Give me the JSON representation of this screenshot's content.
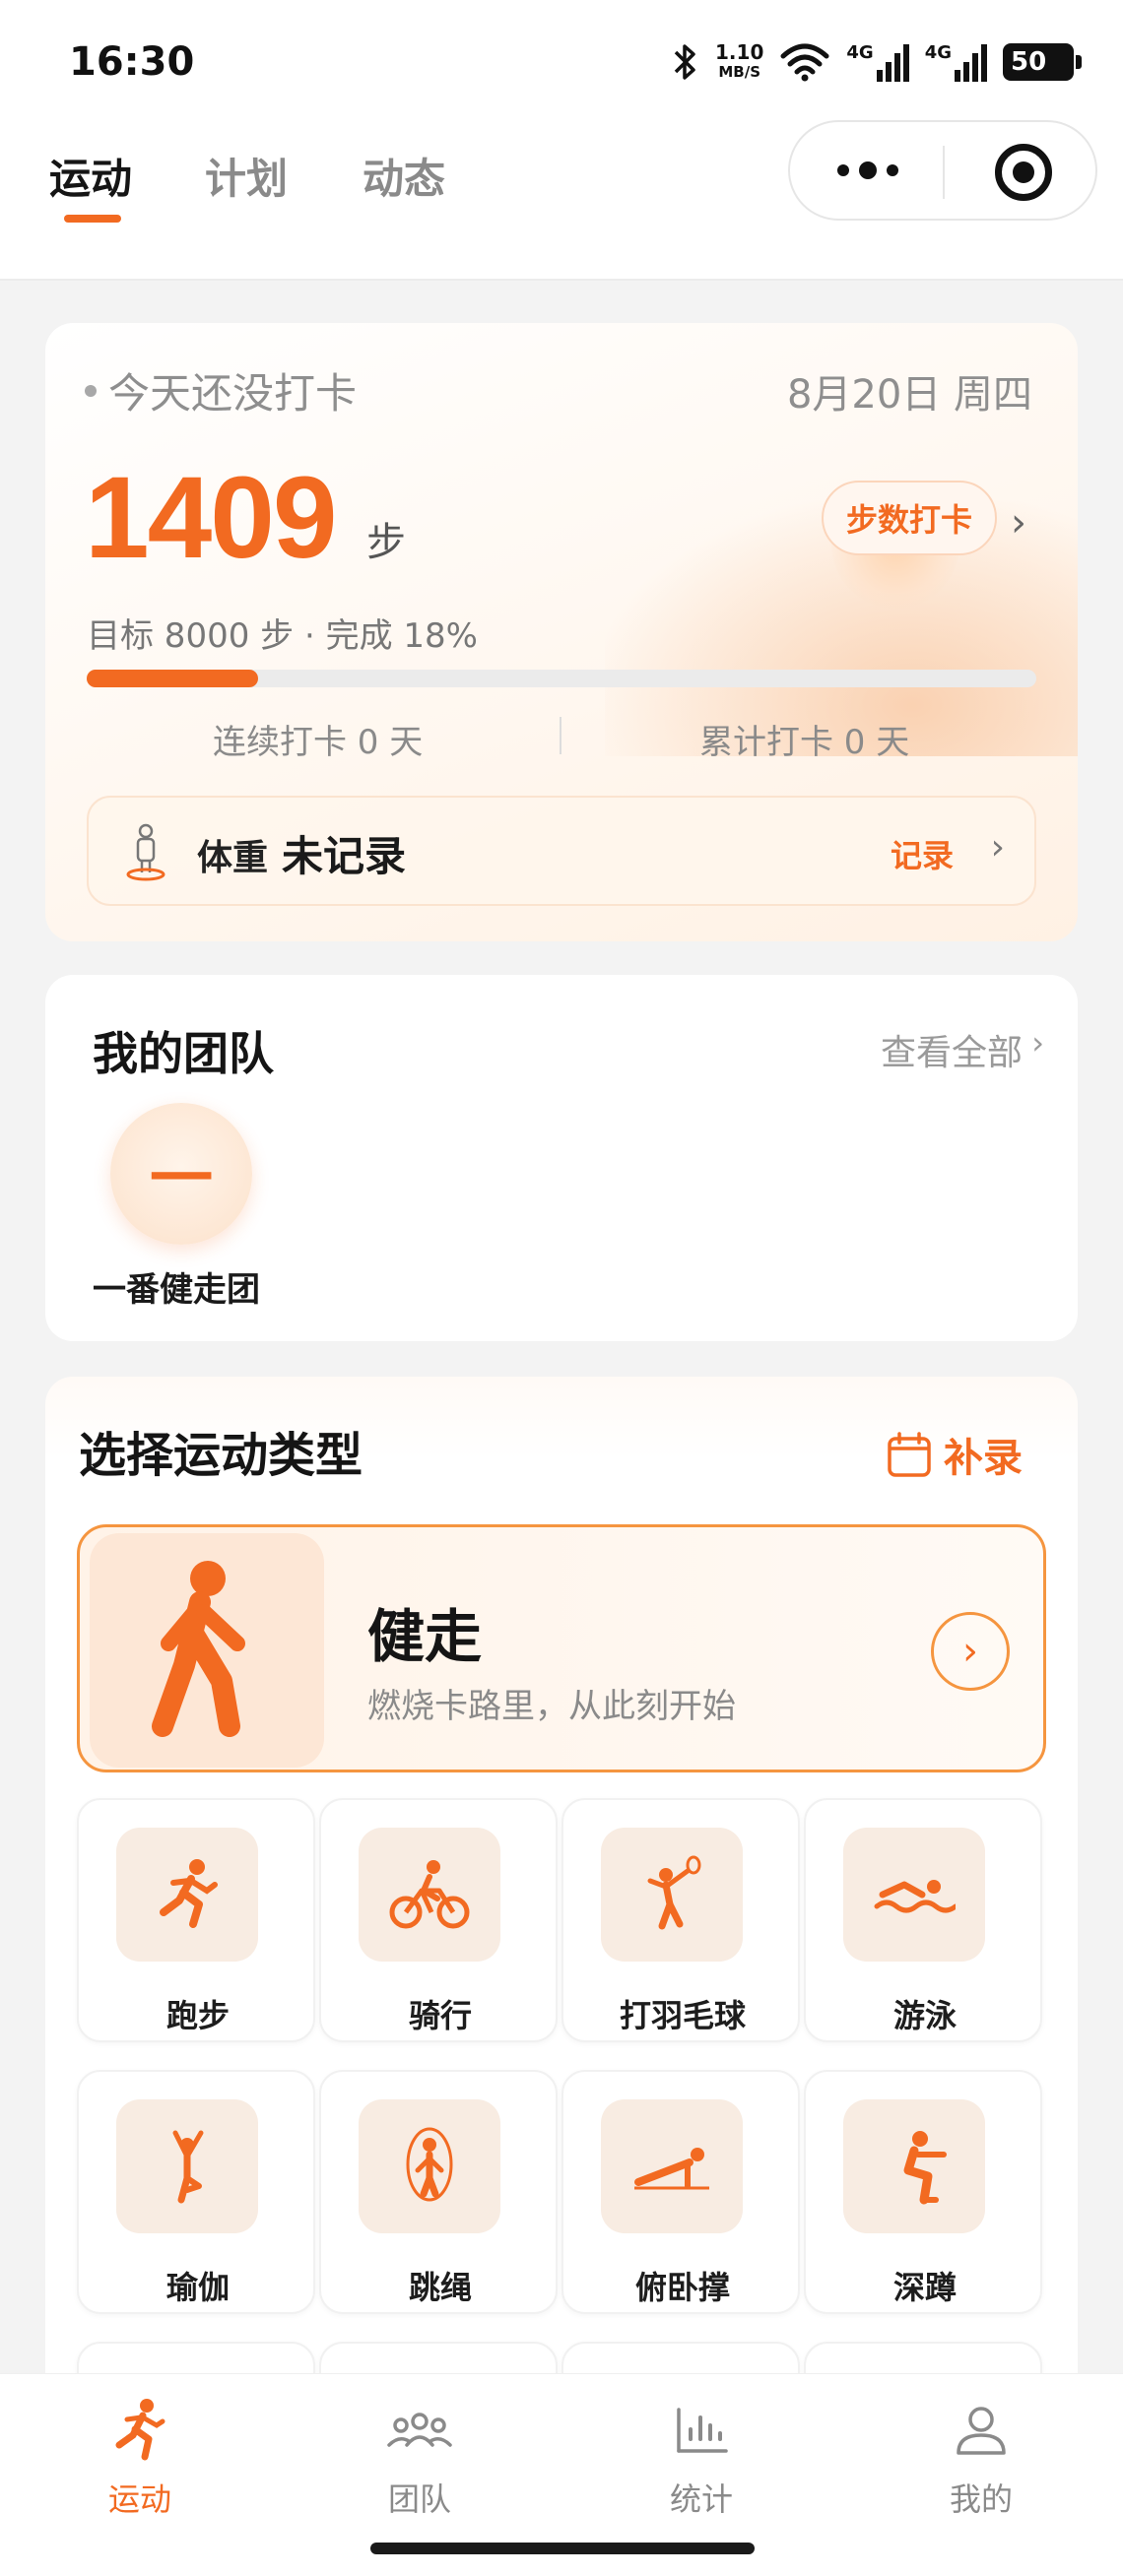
{
  "status_bar": {
    "time": "16:30",
    "net_speed_value": "1.10",
    "net_speed_unit": "MB/S",
    "signal_1": "4G",
    "signal_2": "4G",
    "battery": "50"
  },
  "header": {
    "tabs": [
      {
        "label": "运动",
        "active": true
      },
      {
        "label": "计划",
        "active": false
      },
      {
        "label": "动态",
        "active": false
      }
    ]
  },
  "steps": {
    "checkin_status": "今天还没打卡",
    "date": "8月20日 周四",
    "count": "1409",
    "unit": "步",
    "checkin_button": "步数打卡",
    "goal_text": "目标 8000 步 · 完成 18%",
    "progress_fraction": 0.18,
    "streak": "连续打卡 0 天",
    "total": "累计打卡 0 天"
  },
  "weight": {
    "label": "体重",
    "value": "未记录",
    "record_button": "记录"
  },
  "team": {
    "title": "我的团队",
    "view_all": "查看全部",
    "avatar_char": "一",
    "name": "一番健走团"
  },
  "sport": {
    "title": "选择运动类型",
    "supplement": "补录",
    "featured": {
      "title": "健走",
      "subtitle": "燃烧卡路里，从此刻开始",
      "icon": "walking-icon"
    },
    "items": [
      {
        "label": "跑步",
        "icon": "running-icon"
      },
      {
        "label": "骑行",
        "icon": "cycling-icon"
      },
      {
        "label": "打羽毛球",
        "icon": "badminton-icon"
      },
      {
        "label": "游泳",
        "icon": "swimming-icon"
      },
      {
        "label": "瑜伽",
        "icon": "yoga-icon"
      },
      {
        "label": "跳绳",
        "icon": "jump-rope-icon"
      },
      {
        "label": "俯卧撑",
        "icon": "pushup-icon"
      },
      {
        "label": "深蹲",
        "icon": "squat-icon"
      }
    ]
  },
  "bottom_nav": [
    {
      "label": "运动",
      "icon": "running-icon",
      "active": true
    },
    {
      "label": "团队",
      "icon": "team-icon",
      "active": false
    },
    {
      "label": "统计",
      "icon": "chart-icon",
      "active": false
    },
    {
      "label": "我的",
      "icon": "profile-icon",
      "active": false
    }
  ],
  "colors": {
    "accent": "#f26a21",
    "background": "#f3f3f3",
    "tile_bg": "#f8ece2"
  }
}
